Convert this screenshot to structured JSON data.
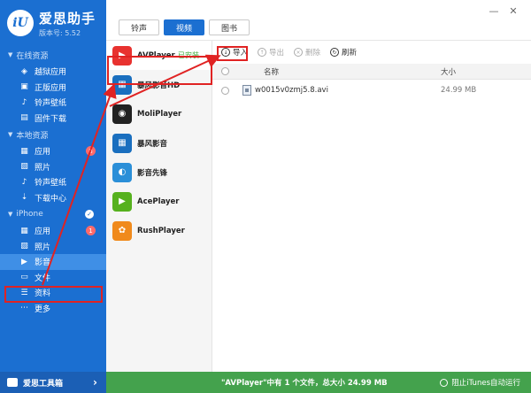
{
  "brand": {
    "name": "爱思助手",
    "version": "版本号: 5.52",
    "logo_text": "iU"
  },
  "sidebar": {
    "sections": [
      {
        "label": "在线资源",
        "items": [
          {
            "label": "越狱应用",
            "icon": "layers-icon"
          },
          {
            "label": "正版应用",
            "icon": "store-icon"
          },
          {
            "label": "铃声壁纸",
            "icon": "music-icon"
          },
          {
            "label": "固件下载",
            "icon": "box-icon"
          }
        ]
      },
      {
        "label": "本地资源",
        "items": [
          {
            "label": "应用",
            "icon": "apps-icon",
            "badge": "8"
          },
          {
            "label": "照片",
            "icon": "photo-icon"
          },
          {
            "label": "铃声壁纸",
            "icon": "music-icon"
          },
          {
            "label": "下载中心",
            "icon": "download-icon"
          }
        ]
      },
      {
        "label": "iPhone",
        "items": [
          {
            "label": "应用",
            "icon": "apps-icon",
            "badge": "1"
          },
          {
            "label": "照片",
            "icon": "photo-icon"
          },
          {
            "label": "影音",
            "icon": "film-icon",
            "active": true
          },
          {
            "label": "文件",
            "icon": "folder-icon"
          },
          {
            "label": "资料",
            "icon": "contacts-icon"
          },
          {
            "label": "更多",
            "icon": "more-icon"
          }
        ]
      }
    ],
    "toolbox": "爱思工具箱"
  },
  "tabs": [
    {
      "label": "铃声",
      "active": false
    },
    {
      "label": "视频",
      "active": true
    },
    {
      "label": "图书",
      "active": false
    }
  ],
  "apps": [
    {
      "name": "AVPlayer",
      "installed": "已安装",
      "color": "#e8322f",
      "glyph": "▶"
    },
    {
      "name": "暴风影音HD",
      "color": "#1a6fbf",
      "glyph": "▦"
    },
    {
      "name": "MoliPlayer",
      "color": "#222222",
      "glyph": "◉"
    },
    {
      "name": "暴风影音",
      "color": "#1a6fbf",
      "glyph": "▦"
    },
    {
      "name": "影音先锋",
      "color": "#2b8fd8",
      "glyph": "◐"
    },
    {
      "name": "AcePlayer",
      "color": "#56b11e",
      "glyph": "▶"
    },
    {
      "name": "RushPlayer",
      "color": "#f08a1c",
      "glyph": "✿"
    }
  ],
  "actions": [
    {
      "label": "导入",
      "disabled": false,
      "glyph": "↓"
    },
    {
      "label": "导出",
      "disabled": true,
      "glyph": "↑"
    },
    {
      "label": "删除",
      "disabled": true,
      "glyph": "×"
    },
    {
      "label": "刷新",
      "disabled": false,
      "glyph": "↻"
    }
  ],
  "table": {
    "headers": {
      "name": "名称",
      "size": "大小"
    },
    "rows": [
      {
        "name": "w0015v0zmj5.8.avi",
        "size": "24.99 MB"
      }
    ]
  },
  "status": {
    "summary": "\"AVPlayer\"中有 1 个文件，总大小 24.99 MB",
    "itunes": "阻止iTunes自动运行"
  },
  "colors": {
    "sidebar": "#1b6fd1",
    "status": "#44a24d",
    "annotation": "#e02323"
  }
}
